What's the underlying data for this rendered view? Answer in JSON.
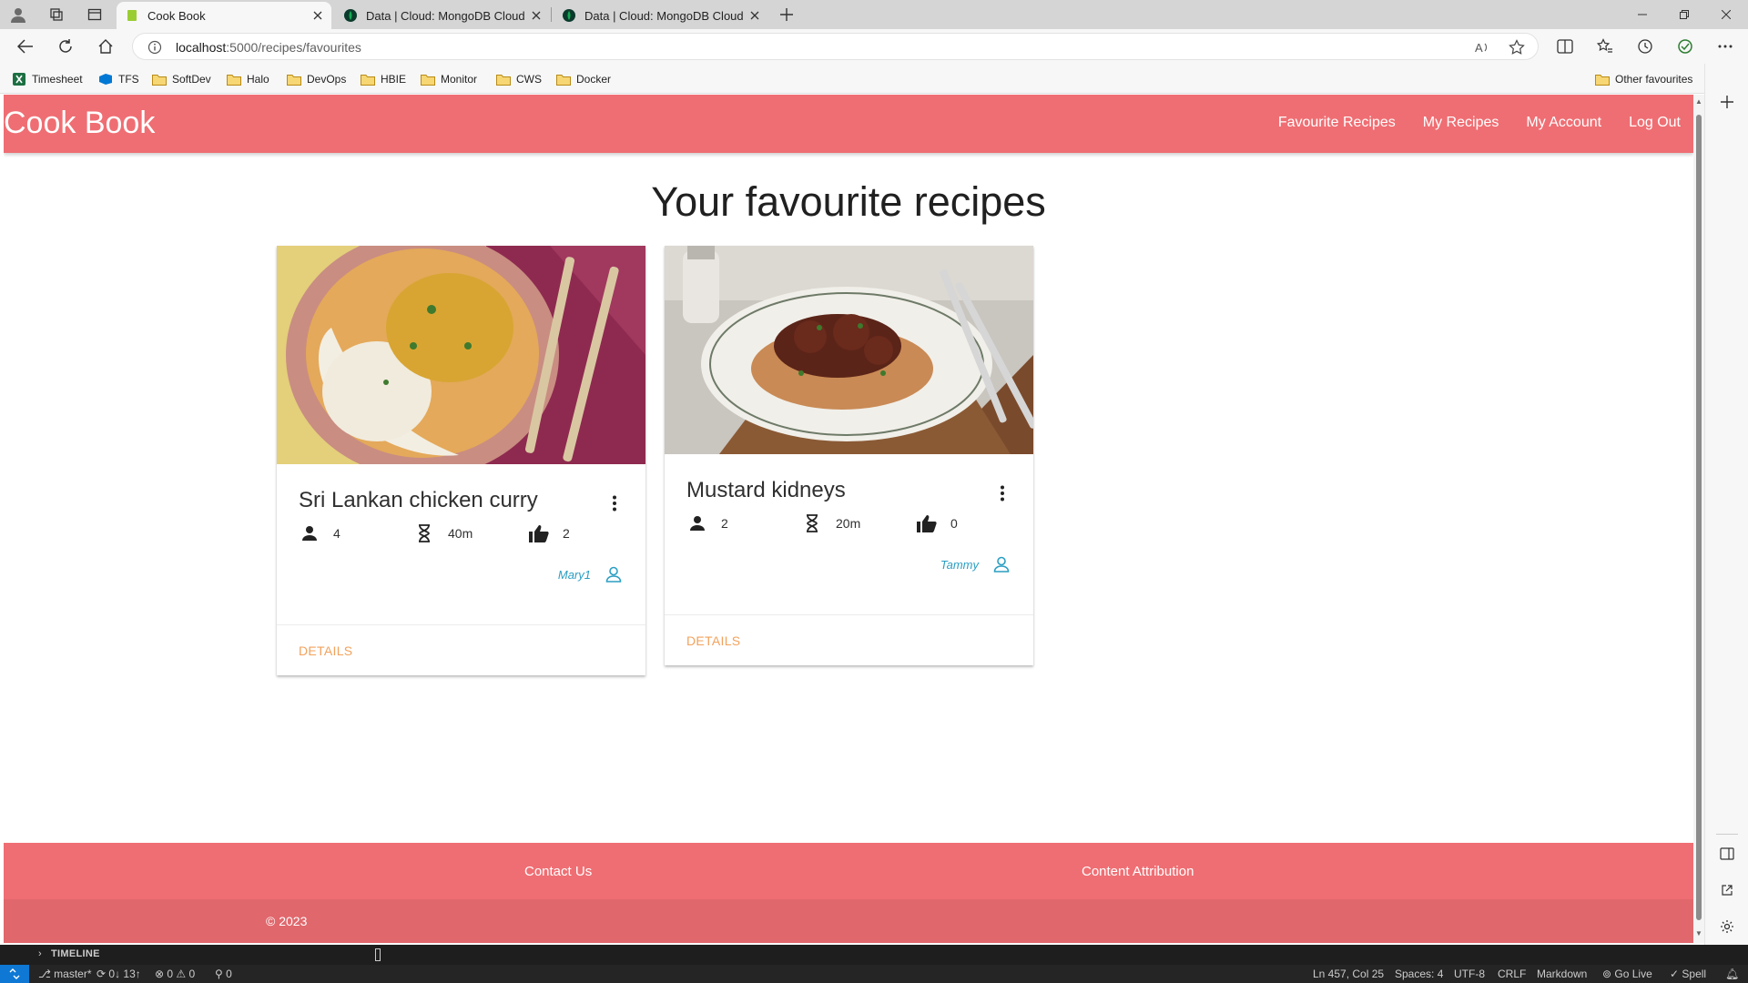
{
  "browser": {
    "tabs": [
      {
        "title": "Cook Book",
        "active": true
      },
      {
        "title": "Data | Cloud: MongoDB Cloud",
        "active": false
      },
      {
        "title": "Data | Cloud: MongoDB Cloud",
        "active": false
      }
    ],
    "url_host": "localhost",
    "url_path": ":5000/recipes/favourites",
    "bookmarks": [
      "Timesheet",
      "TFS",
      "SoftDev",
      "Halo",
      "DevOps",
      "HBIE",
      "Monitor",
      "CWS",
      "Docker"
    ],
    "other_favourites": "Other favourites"
  },
  "app": {
    "brand": "Cook Book",
    "nav": [
      "Favourite Recipes",
      "My Recipes",
      "My Account",
      "Log Out"
    ],
    "page_title": "Your favourite recipes",
    "recipes": [
      {
        "title": "Sri Lankan chicken curry",
        "serves": "4",
        "time": "40m",
        "likes": "2",
        "author": "Mary1",
        "action": "DETAILS"
      },
      {
        "title": "Mustard kidneys",
        "serves": "2",
        "time": "20m",
        "likes": "0",
        "author": "Tammy",
        "action": "DETAILS"
      }
    ],
    "footer": {
      "contact": "Contact Us",
      "attribution": "Content Attribution",
      "copyright": "© 2023"
    }
  },
  "colors": {
    "brand": "#ef6e73",
    "action": "#f2a25c",
    "author": "#2b9ec2"
  },
  "vscode": {
    "timeline_label": "TIMELINE",
    "branch": "master*",
    "sync": "0↓ 13↑",
    "problems_errors": "0",
    "problems_warnings": "0",
    "ports": "0",
    "position": "Ln 457, Col 25",
    "spaces": "Spaces: 4",
    "encoding": "UTF-8",
    "eol": "CRLF",
    "language": "Markdown",
    "go_live": "Go Live",
    "spell": "Spell"
  }
}
